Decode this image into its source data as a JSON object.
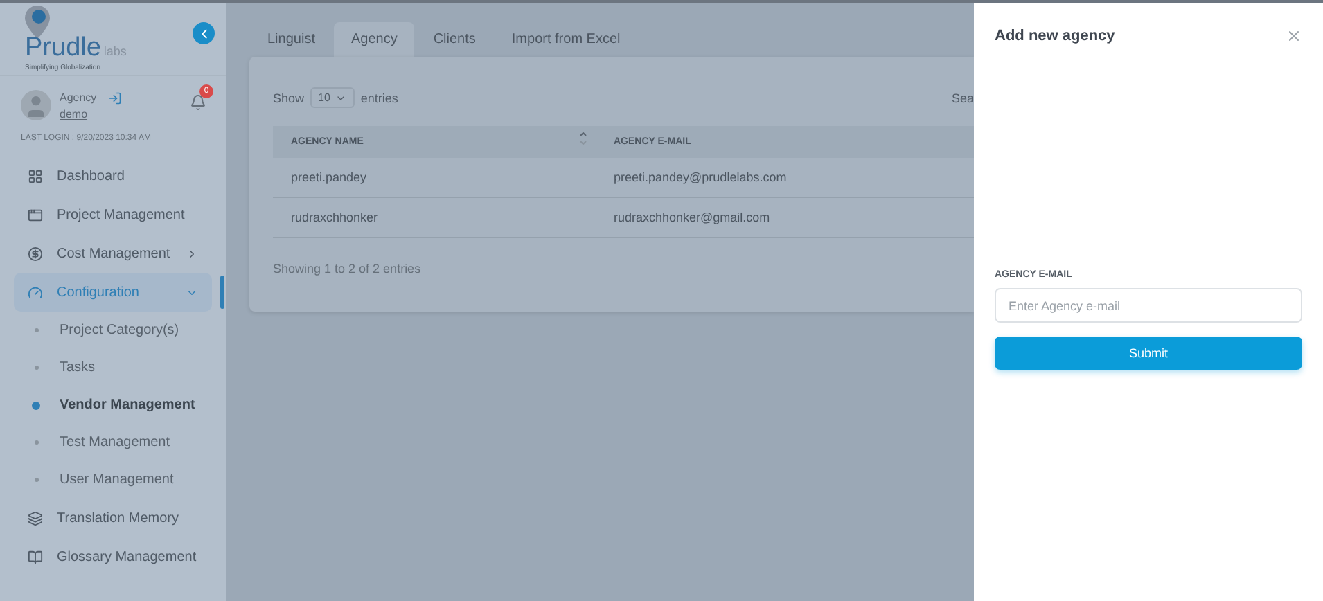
{
  "brand": {
    "name": "Prudle",
    "suffix": "labs",
    "tagline": "Simplifying Globalization"
  },
  "user": {
    "role": "Agency",
    "name": "demo",
    "notifications": "0",
    "last_login": "LAST LOGIN : 9/20/2023 10:34 AM"
  },
  "sidebar": {
    "items": [
      {
        "label": "Dashboard",
        "kind": "link",
        "selected": false
      },
      {
        "label": "Project Management",
        "kind": "link",
        "selected": false
      },
      {
        "label": "Cost Management",
        "kind": "group",
        "selected": false,
        "expanded": false
      },
      {
        "label": "Configuration",
        "kind": "group",
        "selected": true,
        "expanded": true,
        "children": [
          {
            "label": "Project Category(s)",
            "selected": false
          },
          {
            "label": "Tasks",
            "selected": false
          },
          {
            "label": "Vendor Management",
            "selected": true
          },
          {
            "label": "Test Management",
            "selected": false
          },
          {
            "label": "User Management",
            "selected": false
          }
        ]
      },
      {
        "label": "Translation Memory",
        "kind": "link",
        "selected": false
      },
      {
        "label": "Glossary Management",
        "kind": "link",
        "selected": false
      }
    ]
  },
  "tabs": [
    {
      "label": "Linguist",
      "selected": false
    },
    {
      "label": "Agency",
      "selected": true
    },
    {
      "label": "Clients",
      "selected": false
    },
    {
      "label": "Import from Excel",
      "selected": false
    }
  ],
  "table": {
    "show_label": "Show",
    "page_size": "10",
    "entries_label": "entries",
    "search_label": "Sea",
    "columns": [
      "AGENCY NAME",
      "AGENCY E-MAIL"
    ],
    "rows": [
      [
        "preeti.pandey",
        "preeti.pandey@prudlelabs.com"
      ],
      [
        "rudraxchhonker",
        "rudraxchhonker@gmail.com"
      ]
    ],
    "info": "Showing 1 to 2 of 2 entries"
  },
  "drawer": {
    "title": "Add new agency",
    "field_label": "AGENCY E-MAIL",
    "placeholder": "Enter Agency e-mail",
    "submit": "Submit"
  }
}
